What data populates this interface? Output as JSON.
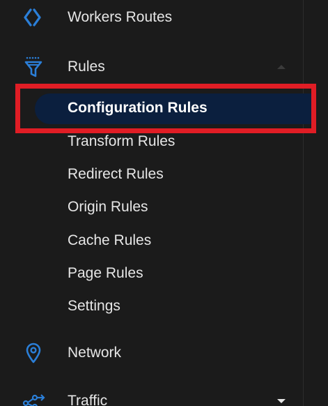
{
  "colors": {
    "background": "#1b1b1b",
    "icon_blue": "#2b7fd8",
    "active_bg": "#0b1f3e",
    "highlight": "#e01d25",
    "text": "#e6e6e6"
  },
  "nav": {
    "workers_routes": {
      "label": "Workers Routes",
      "icon": "workers-icon"
    },
    "rules": {
      "label": "Rules",
      "icon": "funnel-icon",
      "expanded": true,
      "children": [
        {
          "label": "Configuration Rules",
          "active": true
        },
        {
          "label": "Transform Rules"
        },
        {
          "label": "Redirect Rules"
        },
        {
          "label": "Origin Rules"
        },
        {
          "label": "Cache Rules"
        },
        {
          "label": "Page Rules"
        },
        {
          "label": "Settings"
        }
      ]
    },
    "network": {
      "label": "Network",
      "icon": "location-pin-icon"
    },
    "traffic": {
      "label": "Traffic",
      "icon": "network-graph-icon",
      "expanded": false
    }
  }
}
